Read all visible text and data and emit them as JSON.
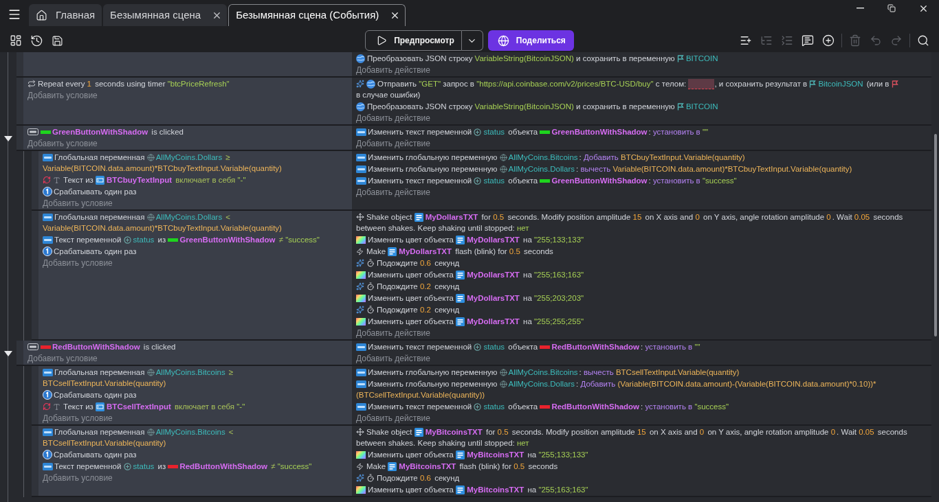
{
  "tabs": [
    {
      "kind": "home",
      "label": "Главная",
      "selected": false
    },
    {
      "kind": "scene",
      "label": "Безымянная сцена",
      "selected": false
    },
    {
      "kind": "scene",
      "label": "Безымянная сцена (События)",
      "selected": true
    }
  ],
  "toolbar": {
    "preview_button": "Предпросмотр",
    "share_button": "Поделиться",
    "tools": [
      {
        "kind": "add_event",
        "disabled": false
      },
      {
        "kind": "add_subevent",
        "disabled": true
      },
      {
        "kind": "add_other",
        "disabled": true
      },
      {
        "kind": "add_comment",
        "disabled": false
      },
      {
        "kind": "add_menu",
        "disabled": false
      },
      {
        "kind": "delete",
        "disabled": true
      },
      {
        "kind": "undo",
        "disabled": true
      },
      {
        "kind": "redo",
        "disabled": true
      },
      {
        "kind": "search",
        "disabled": false
      }
    ]
  },
  "events": [
    {
      "actions": [
        {
          "kind": "json",
          "segments": [
            {
              "kind": "text",
              "text": "Преобразовать JSON строку "
            },
            {
              "kind": "string",
              "text": "VariableString(BitcoinJSON)"
            },
            {
              "kind": "text",
              "text": " и сохранить в переменную "
            },
            {
              "kind": "scene_variable",
              "text": "BITCOIN"
            }
          ]
        }
      ],
      "add_action": "Добавить действие"
    },
    {
      "conditions": [
        {
          "kind": "repeat",
          "inverted": false,
          "segments": [
            {
              "kind": "text",
              "text": "Repeat every "
            },
            {
              "kind": "number",
              "text": "1"
            },
            {
              "kind": "text",
              "text": " seconds using timer "
            },
            {
              "kind": "string",
              "text": "\"btcPriceRefresh\""
            }
          ]
        }
      ],
      "add_condition": "Добавить условие",
      "actions": [
        {
          "kind": "request",
          "segments": [
            {
              "kind": "text",
              "text": "Отправить "
            },
            {
              "kind": "string",
              "text": "\"GET\""
            },
            {
              "kind": "text",
              "text": " запрос в "
            },
            {
              "kind": "string",
              "text": "\"https://api.coinbase.com/v2/prices/BTC-USD/buy\""
            },
            {
              "kind": "text",
              "text": " с телом: "
            },
            {
              "kind": "empty_value"
            },
            {
              "kind": "text",
              "text": ", и сохранить результат в "
            },
            {
              "kind": "scene_variable",
              "text": "BitcoinJSON"
            },
            {
              "kind": "text",
              "text": " (или в "
            },
            {
              "kind": "missing_variable"
            },
            {
              "kind": "text",
              "text": "в случае ошибки)"
            }
          ]
        },
        {
          "kind": "json",
          "segments": [
            {
              "kind": "text",
              "text": "Преобразовать JSON строку "
            },
            {
              "kind": "string",
              "text": "VariableString(BitcoinJSON)"
            },
            {
              "kind": "text",
              "text": " и сохранить в переменную "
            },
            {
              "kind": "scene_variable",
              "text": "BITCOIN"
            }
          ]
        }
      ],
      "add_action": "Добавить действие"
    },
    {
      "expanded": true,
      "conditions": [
        {
          "kind": "click",
          "inverted": false,
          "segments": [
            {
              "kind": "button_object",
              "text": "GreenButtonWithShadow",
              "color": "#1ed41e"
            },
            {
              "kind": "text",
              "text": " is clicked"
            }
          ]
        }
      ],
      "add_condition": "Добавить условие",
      "actions": [
        {
          "kind": "variable",
          "segments": [
            {
              "kind": "text",
              "text": "Изменить текст переменной "
            },
            {
              "kind": "object_variable",
              "text": "status"
            },
            {
              "kind": "text",
              "text": " объекта "
            },
            {
              "kind": "button_object",
              "text": "GreenButtonWithShadow",
              "color": "#1ed41e"
            },
            {
              "kind": "text",
              "text": ": "
            },
            {
              "kind": "keyword",
              "text": "установить в "
            },
            {
              "kind": "string",
              "text": "\"\""
            }
          ]
        }
      ],
      "add_action": "Добавить действие",
      "children": [
        {
          "conditions": [
            {
              "kind": "variable",
              "inverted": false,
              "segments": [
                {
                  "kind": "text",
                  "text": "Глобальная переменная "
                },
                {
                  "kind": "global_variable",
                  "text": "AllMyCoins.Dollars"
                },
                {
                  "kind": "operator",
                  "text": " ≥ "
                },
                {
                  "kind": "expression",
                  "text": "Variable(BITCOIN.data.amount)*BTCbuyTextInput.Variable(quantity)"
                }
              ]
            },
            {
              "kind": "text_check",
              "inverted": true,
              "segments": [
                {
                  "kind": "text",
                  "text": "Текст из "
                },
                {
                  "kind": "input_object",
                  "text": "BTCbuyTextInput"
                },
                {
                  "kind": "operator",
                  "text": " включает в себя "
                },
                {
                  "kind": "string",
                  "text": "\"-\""
                }
              ]
            },
            {
              "kind": "trigger_once",
              "inverted": false,
              "segments": [
                {
                  "kind": "text",
                  "text": "Срабатывать один раз"
                }
              ]
            }
          ],
          "add_condition": "Добавить условие",
          "actions": [
            {
              "kind": "variable",
              "segments": [
                {
                  "kind": "text",
                  "text": "Изменить глобальную переменную "
                },
                {
                  "kind": "global_variable",
                  "text": "AllMyCoins.Bitcoins"
                },
                {
                  "kind": "text",
                  "text": ": "
                },
                {
                  "kind": "keyword",
                  "text": "Добавить "
                },
                {
                  "kind": "expression",
                  "text": "BTCbuyTextInput.Variable(quantity)"
                }
              ]
            },
            {
              "kind": "variable",
              "segments": [
                {
                  "kind": "text",
                  "text": "Изменить глобальную переменную "
                },
                {
                  "kind": "global_variable",
                  "text": "AllMyCoins.Dollars"
                },
                {
                  "kind": "text",
                  "text": ": "
                },
                {
                  "kind": "keyword",
                  "text": "вычесть "
                },
                {
                  "kind": "expression",
                  "text": "Variable(BITCOIN.data.amount)*BTCbuyTextInput.Variable(quantity)"
                }
              ]
            },
            {
              "kind": "variable",
              "segments": [
                {
                  "kind": "text",
                  "text": "Изменить текст переменной "
                },
                {
                  "kind": "object_variable",
                  "text": "status"
                },
                {
                  "kind": "text",
                  "text": " объекта "
                },
                {
                  "kind": "button_object",
                  "text": "GreenButtonWithShadow",
                  "color": "#1ed41e"
                },
                {
                  "kind": "text",
                  "text": ": "
                },
                {
                  "kind": "keyword",
                  "text": "установить в "
                },
                {
                  "kind": "string",
                  "text": "\"success\""
                }
              ]
            }
          ],
          "add_action": "Добавить действие"
        },
        {
          "conditions": [
            {
              "kind": "variable",
              "inverted": false,
              "segments": [
                {
                  "kind": "text",
                  "text": "Глобальная переменная "
                },
                {
                  "kind": "global_variable",
                  "text": "AllMyCoins.Dollars"
                },
                {
                  "kind": "operator",
                  "text": " < "
                },
                {
                  "kind": "expression",
                  "text": "Variable(BITCOIN.data.amount)*BTCbuyTextInput.Variable(quantity)"
                }
              ]
            },
            {
              "kind": "variable",
              "inverted": false,
              "segments": [
                {
                  "kind": "text",
                  "text": "Текст переменной "
                },
                {
                  "kind": "object_variable",
                  "text": "status"
                },
                {
                  "kind": "text",
                  "text": " из "
                },
                {
                  "kind": "button_object",
                  "text": "GreenButtonWithShadow",
                  "color": "#1ed41e"
                },
                {
                  "kind": "operator",
                  "text": " ≠ "
                },
                {
                  "kind": "string",
                  "text": "\"success\""
                }
              ]
            },
            {
              "kind": "trigger_once",
              "inverted": false,
              "segments": [
                {
                  "kind": "text",
                  "text": "Срабатывать один раз"
                }
              ]
            }
          ],
          "add_condition": "Добавить условие",
          "actions": [
            {
              "kind": "shake",
              "segments": [
                {
                  "kind": "text",
                  "text": "Shake object "
                },
                {
                  "kind": "text_object",
                  "text": "MyDollarsTXT"
                },
                {
                  "kind": "text",
                  "text": " for "
                },
                {
                  "kind": "number",
                  "text": "0.5"
                },
                {
                  "kind": "text",
                  "text": " seconds. Modify position amplitude "
                },
                {
                  "kind": "number",
                  "text": "15"
                },
                {
                  "kind": "text",
                  "text": " on X axis and "
                },
                {
                  "kind": "number",
                  "text": "0"
                },
                {
                  "kind": "text",
                  "text": " on Y axis, angle rotation amplitude "
                },
                {
                  "kind": "number",
                  "text": "0"
                },
                {
                  "kind": "text",
                  "text": ". Wait "
                },
                {
                  "kind": "number",
                  "text": "0.05"
                },
                {
                  "kind": "text",
                  "text": " seconds "
                },
                {
                  "kind": "text",
                  "text": "between shakes. Keep shaking until stopped: "
                },
                {
                  "kind": "string",
                  "text": "нет"
                }
              ]
            },
            {
              "kind": "color",
              "segments": [
                {
                  "kind": "text",
                  "text": "Изменить цвет объекта "
                },
                {
                  "kind": "text_object",
                  "text": "MyDollarsTXT"
                },
                {
                  "kind": "text",
                  "text": " на "
                },
                {
                  "kind": "string",
                  "text": "\"255;133;133\""
                }
              ]
            },
            {
              "kind": "flash",
              "segments": [
                {
                  "kind": "text",
                  "text": "Make "
                },
                {
                  "kind": "text_object",
                  "text": "MyDollarsTXT"
                },
                {
                  "kind": "text",
                  "text": " flash (blink) for "
                },
                {
                  "kind": "number",
                  "text": "0.5"
                },
                {
                  "kind": "text",
                  "text": " seconds"
                }
              ]
            },
            {
              "kind": "wait",
              "segments": [
                {
                  "kind": "text",
                  "text": "Подождите "
                },
                {
                  "kind": "number",
                  "text": "0.6"
                },
                {
                  "kind": "text",
                  "text": " секунд"
                }
              ]
            },
            {
              "kind": "color",
              "segments": [
                {
                  "kind": "text",
                  "text": "Изменить цвет объекта "
                },
                {
                  "kind": "text_object",
                  "text": "MyDollarsTXT"
                },
                {
                  "kind": "text",
                  "text": " на "
                },
                {
                  "kind": "string",
                  "text": "\"255;163;163\""
                }
              ]
            },
            {
              "kind": "wait",
              "segments": [
                {
                  "kind": "text",
                  "text": "Подождите "
                },
                {
                  "kind": "number",
                  "text": "0.2"
                },
                {
                  "kind": "text",
                  "text": " секунд"
                }
              ]
            },
            {
              "kind": "color",
              "segments": [
                {
                  "kind": "text",
                  "text": "Изменить цвет объекта "
                },
                {
                  "kind": "text_object",
                  "text": "MyDollarsTXT"
                },
                {
                  "kind": "text",
                  "text": " на "
                },
                {
                  "kind": "string",
                  "text": "\"255;203;203\""
                }
              ]
            },
            {
              "kind": "wait",
              "segments": [
                {
                  "kind": "text",
                  "text": "Подождите "
                },
                {
                  "kind": "number",
                  "text": "0.2"
                },
                {
                  "kind": "text",
                  "text": " секунд"
                }
              ]
            },
            {
              "kind": "color",
              "segments": [
                {
                  "kind": "text",
                  "text": "Изменить цвет объекта "
                },
                {
                  "kind": "text_object",
                  "text": "MyDollarsTXT"
                },
                {
                  "kind": "text",
                  "text": " на "
                },
                {
                  "kind": "string",
                  "text": "\"255;255;255\""
                }
              ]
            }
          ],
          "add_action": "Добавить действие"
        }
      ]
    },
    {
      "expanded": true,
      "conditions": [
        {
          "kind": "click",
          "inverted": false,
          "segments": [
            {
              "kind": "button_object",
              "text": "RedButtonWithShadow",
              "color": "#e8222c"
            },
            {
              "kind": "text",
              "text": " is clicked"
            }
          ]
        }
      ],
      "add_condition": "Добавить условие",
      "actions": [
        {
          "kind": "variable",
          "segments": [
            {
              "kind": "text",
              "text": "Изменить текст переменной "
            },
            {
              "kind": "object_variable",
              "text": "status"
            },
            {
              "kind": "text",
              "text": " объекта "
            },
            {
              "kind": "button_object",
              "text": "RedButtonWithShadow",
              "color": "#e8222c"
            },
            {
              "kind": "text",
              "text": ": "
            },
            {
              "kind": "keyword",
              "text": "установить в "
            },
            {
              "kind": "string",
              "text": "\"\""
            }
          ]
        }
      ],
      "add_action": "Добавить действие",
      "children": [
        {
          "conditions": [
            {
              "kind": "variable",
              "inverted": false,
              "segments": [
                {
                  "kind": "text",
                  "text": "Глобальная переменная "
                },
                {
                  "kind": "global_variable",
                  "text": "AllMyCoins.Bitcoins"
                },
                {
                  "kind": "operator",
                  "text": " ≥ "
                },
                {
                  "kind": "expression",
                  "text": "BTCsellTextInput.Variable(quantity)"
                }
              ]
            },
            {
              "kind": "trigger_once",
              "inverted": false,
              "segments": [
                {
                  "kind": "text",
                  "text": "Срабатывать один раз"
                }
              ]
            },
            {
              "kind": "text_check",
              "inverted": true,
              "segments": [
                {
                  "kind": "text",
                  "text": "Текст из "
                },
                {
                  "kind": "input_object",
                  "text": "BTCsellTextInput"
                },
                {
                  "kind": "operator",
                  "text": " включает в себя "
                },
                {
                  "kind": "string",
                  "text": "\"-\""
                }
              ]
            }
          ],
          "add_condition": "Добавить условие",
          "actions": [
            {
              "kind": "variable",
              "segments": [
                {
                  "kind": "text",
                  "text": "Изменить глобальную переменную "
                },
                {
                  "kind": "global_variable",
                  "text": "AllMyCoins.Bitcoins"
                },
                {
                  "kind": "text",
                  "text": ": "
                },
                {
                  "kind": "keyword",
                  "text": "вычесть "
                },
                {
                  "kind": "expression",
                  "text": "BTCsellTextInput.Variable(quantity)"
                }
              ]
            },
            {
              "kind": "variable",
              "segments": [
                {
                  "kind": "text",
                  "text": "Изменить глобальную переменную "
                },
                {
                  "kind": "global_variable",
                  "text": "AllMyCoins.Dollars"
                },
                {
                  "kind": "text",
                  "text": ": "
                },
                {
                  "kind": "keyword",
                  "text": "Добавить "
                },
                {
                  "kind": "expression",
                  "text": "(Variable(BITCOIN.data.amount)-(Variable(BITCOIN.data.amount)*0.10))*"
                },
                {
                  "kind": "expression",
                  "text": "(BTCsellTextInput.Variable(quantity))"
                }
              ]
            },
            {
              "kind": "variable",
              "segments": [
                {
                  "kind": "text",
                  "text": "Изменить текст переменной "
                },
                {
                  "kind": "object_variable",
                  "text": "status"
                },
                {
                  "kind": "text",
                  "text": " объекта "
                },
                {
                  "kind": "button_object",
                  "text": "RedButtonWithShadow",
                  "color": "#e8222c"
                },
                {
                  "kind": "text",
                  "text": ": "
                },
                {
                  "kind": "keyword",
                  "text": "установить в "
                },
                {
                  "kind": "string",
                  "text": "\"success\""
                }
              ]
            }
          ],
          "add_action": "Добавить действие"
        },
        {
          "conditions": [
            {
              "kind": "variable",
              "inverted": false,
              "segments": [
                {
                  "kind": "text",
                  "text": "Глобальная переменная "
                },
                {
                  "kind": "global_variable",
                  "text": "AllMyCoins.Bitcoins"
                },
                {
                  "kind": "operator",
                  "text": " < "
                },
                {
                  "kind": "expression",
                  "text": "BTCsellTextInput.Variable(quantity)"
                }
              ]
            },
            {
              "kind": "trigger_once",
              "inverted": false,
              "segments": [
                {
                  "kind": "text",
                  "text": "Срабатывать один раз"
                }
              ]
            },
            {
              "kind": "variable",
              "inverted": false,
              "segments": [
                {
                  "kind": "text",
                  "text": "Текст переменной "
                },
                {
                  "kind": "object_variable",
                  "text": "status"
                },
                {
                  "kind": "text",
                  "text": " из "
                },
                {
                  "kind": "button_object",
                  "text": "RedButtonWithShadow",
                  "color": "#e8222c"
                },
                {
                  "kind": "operator",
                  "text": " ≠ "
                },
                {
                  "kind": "string",
                  "text": "\"success\""
                }
              ]
            }
          ],
          "add_condition": "Добавить условие",
          "actions": [
            {
              "kind": "shake",
              "segments": [
                {
                  "kind": "text",
                  "text": "Shake object "
                },
                {
                  "kind": "text_object",
                  "text": "MyBitcoinsTXT"
                },
                {
                  "kind": "text",
                  "text": " for "
                },
                {
                  "kind": "number",
                  "text": "0.5"
                },
                {
                  "kind": "text",
                  "text": " seconds. Modify position amplitude "
                },
                {
                  "kind": "number",
                  "text": "15"
                },
                {
                  "kind": "text",
                  "text": " on X axis and "
                },
                {
                  "kind": "number",
                  "text": "0"
                },
                {
                  "kind": "text",
                  "text": " on Y axis, angle rotation amplitude "
                },
                {
                  "kind": "number",
                  "text": "0"
                },
                {
                  "kind": "text",
                  "text": ". Wait "
                },
                {
                  "kind": "number",
                  "text": "0.05"
                },
                {
                  "kind": "text",
                  "text": " seconds "
                },
                {
                  "kind": "text",
                  "text": "between shakes. Keep shaking until stopped: "
                },
                {
                  "kind": "string",
                  "text": "нет"
                }
              ]
            },
            {
              "kind": "color",
              "segments": [
                {
                  "kind": "text",
                  "text": "Изменить цвет объекта "
                },
                {
                  "kind": "text_object",
                  "text": "MyBitcoinsTXT"
                },
                {
                  "kind": "text",
                  "text": " на "
                },
                {
                  "kind": "string",
                  "text": "\"255;133;133\""
                }
              ]
            },
            {
              "kind": "flash",
              "segments": [
                {
                  "kind": "text",
                  "text": "Make "
                },
                {
                  "kind": "text_object",
                  "text": "MyBitcoinsTXT"
                },
                {
                  "kind": "text",
                  "text": " flash (blink) for "
                },
                {
                  "kind": "number",
                  "text": "0.5"
                },
                {
                  "kind": "text",
                  "text": " seconds"
                }
              ]
            },
            {
              "kind": "wait",
              "segments": [
                {
                  "kind": "text",
                  "text": "Подождите "
                },
                {
                  "kind": "number",
                  "text": "0.6"
                },
                {
                  "kind": "text",
                  "text": " секунд"
                }
              ]
            },
            {
              "kind": "color",
              "segments": [
                {
                  "kind": "text",
                  "text": "Изменить цвет объекта "
                },
                {
                  "kind": "text_object",
                  "text": "MyBitcoinsTXT"
                },
                {
                  "kind": "text",
                  "text": " на "
                },
                {
                  "kind": "string",
                  "text": "\"255;163;163\""
                }
              ]
            }
          ]
        }
      ]
    }
  ]
}
